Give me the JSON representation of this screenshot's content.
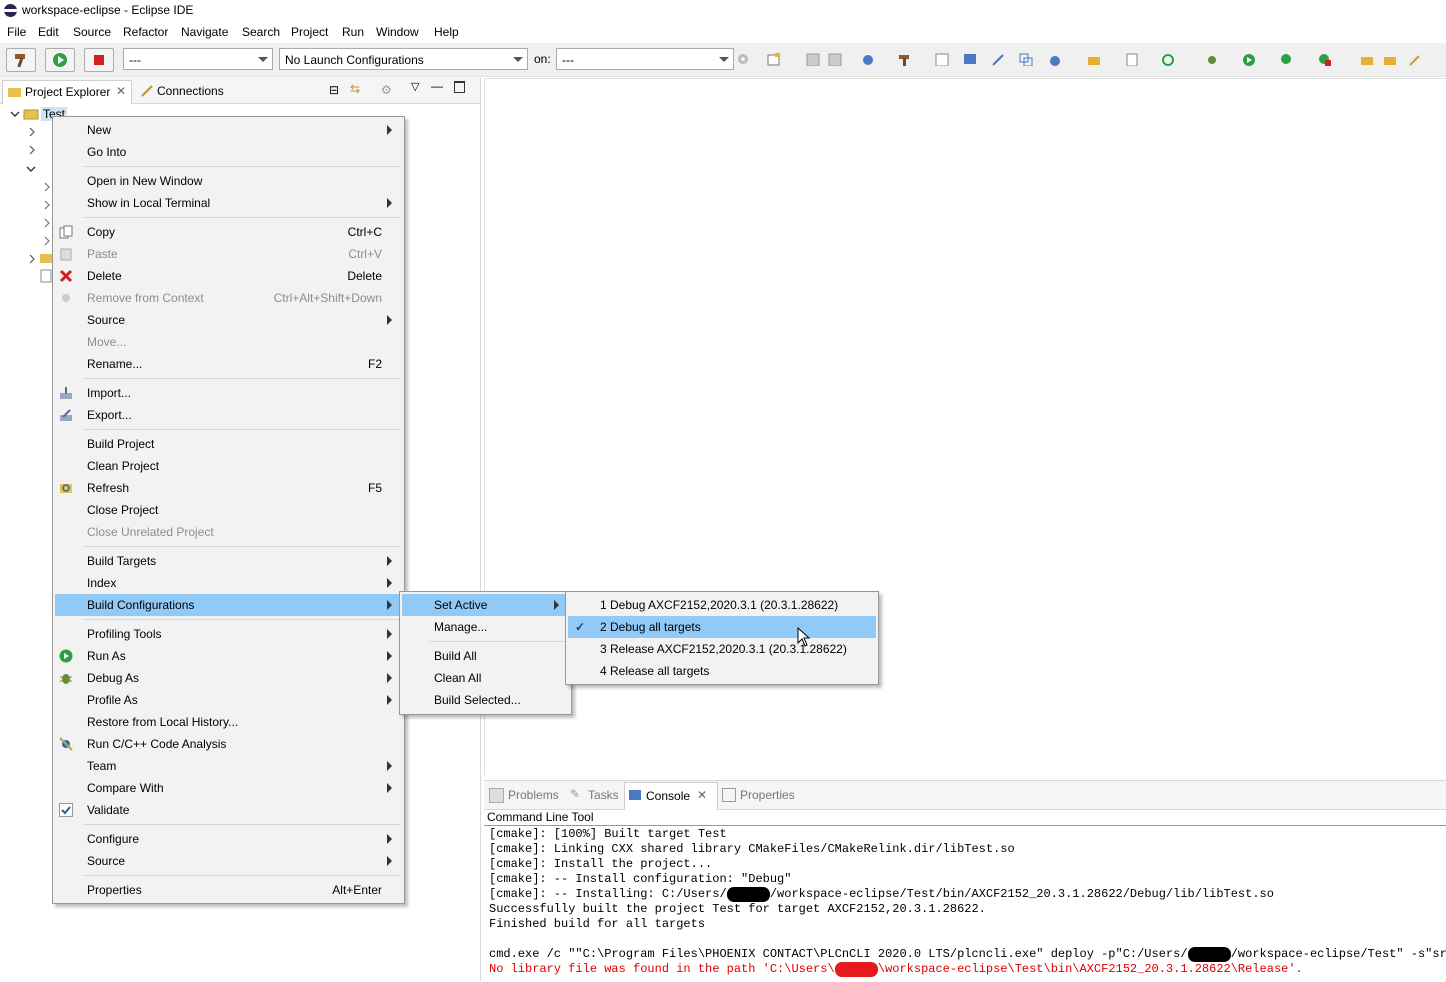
{
  "window": {
    "title": "workspace-eclipse - Eclipse IDE"
  },
  "menubar": [
    "File",
    "Edit",
    "Source",
    "Refactor",
    "Navigate",
    "Search",
    "Project",
    "Run",
    "Window",
    "Help"
  ],
  "toolbar": {
    "build_config_value": "---",
    "launch_config_value": "No Launch Configurations",
    "on_label": "on:",
    "target_value": "---"
  },
  "left_view": {
    "tabs": [
      {
        "label": "Project Explorer",
        "active": true
      },
      {
        "label": "Connections",
        "active": false
      }
    ],
    "tree_root": "Test"
  },
  "context_menu": {
    "items": [
      {
        "label": "New",
        "submenu": true
      },
      {
        "label": "Go Into"
      },
      {
        "sep": true
      },
      {
        "label": "Open in New Window"
      },
      {
        "label": "Show in Local Terminal",
        "submenu": true
      },
      {
        "sep": true
      },
      {
        "label": "Copy",
        "shortcut": "Ctrl+C",
        "icon": "copy-icon"
      },
      {
        "label": "Paste",
        "shortcut": "Ctrl+V",
        "icon": "paste-icon",
        "disabled": true
      },
      {
        "label": "Delete",
        "shortcut": "Delete",
        "icon": "delete-icon"
      },
      {
        "label": "Remove from Context",
        "shortcut": "Ctrl+Alt+Shift+Down",
        "icon": "remove-context-icon",
        "disabled": true
      },
      {
        "label": "Source",
        "submenu": true
      },
      {
        "label": "Move...",
        "disabled": true
      },
      {
        "label": "Rename...",
        "shortcut": "F2"
      },
      {
        "sep": true
      },
      {
        "label": "Import...",
        "icon": "import-icon"
      },
      {
        "label": "Export...",
        "icon": "export-icon"
      },
      {
        "sep": true
      },
      {
        "label": "Build Project"
      },
      {
        "label": "Clean Project"
      },
      {
        "label": "Refresh",
        "shortcut": "F5",
        "icon": "refresh-icon"
      },
      {
        "label": "Close Project"
      },
      {
        "label": "Close Unrelated Project",
        "disabled": true
      },
      {
        "sep": true
      },
      {
        "label": "Build Targets",
        "submenu": true
      },
      {
        "label": "Index",
        "submenu": true
      },
      {
        "label": "Build Configurations",
        "submenu": true,
        "highlighted": true
      },
      {
        "sep": true
      },
      {
        "label": "Profiling Tools",
        "submenu": true
      },
      {
        "label": "Run As",
        "submenu": true,
        "icon": "run-icon"
      },
      {
        "label": "Debug As",
        "submenu": true,
        "icon": "debug-icon"
      },
      {
        "label": "Profile As",
        "submenu": true
      },
      {
        "label": "Restore from Local History..."
      },
      {
        "label": "Run C/C++ Code Analysis",
        "icon": "code-analysis-icon"
      },
      {
        "label": "Team",
        "submenu": true
      },
      {
        "label": "Compare With",
        "submenu": true
      },
      {
        "label": "Validate",
        "icon": "validate-check-icon"
      },
      {
        "sep": true
      },
      {
        "label": "Configure",
        "submenu": true
      },
      {
        "label": "Source",
        "submenu": true
      },
      {
        "sep": true
      },
      {
        "label": "Properties",
        "shortcut": "Alt+Enter"
      }
    ]
  },
  "build_config_menu": {
    "items": [
      {
        "label": "Set Active",
        "submenu": true,
        "highlighted": true
      },
      {
        "label": "Manage..."
      },
      {
        "sep": true
      },
      {
        "label": "Build All"
      },
      {
        "label": "Clean All"
      },
      {
        "label": "Build Selected..."
      }
    ]
  },
  "set_active_menu": {
    "items": [
      {
        "label": "1 Debug AXCF2152,2020.3.1 (20.3.1.28622)"
      },
      {
        "label": "2 Debug all targets",
        "checked": true,
        "highlighted": true
      },
      {
        "label": "3 Release AXCF2152,2020.3.1 (20.3.1.28622)"
      },
      {
        "label": "4 Release all targets"
      }
    ]
  },
  "console_view": {
    "tabs": [
      "Problems",
      "Tasks",
      "Console",
      "Properties"
    ],
    "active_tab": "Console",
    "header": "Command Line Tool",
    "lines": [
      "[cmake]: [100%] Built target Test",
      "[cmake]: Linking CXX shared library CMakeFiles/CMakeRelink.dir/libTest.so",
      "[cmake]: Install the project...",
      "[cmake]: -- Install configuration: \"Debug\"",
      "[cmake]: -- Installing: C:/Users/",
      "/workspace-eclipse/Test/bin/AXCF2152_20.3.1.28622/Debug/lib/libTest.so",
      "Successfully built the project Test for target AXCF2152,20.3.1.28622.",
      "Finished build for all targets",
      "cmd.exe /c \"\"C:\\Program Files\\PHOENIX CONTACT\\PLCnCLI 2020.0 LTS/plcncli.exe\" deploy -p\"C:/Users/",
      "/workspace-eclipse/Test\" -s\"src\"\"",
      "No library file was found in the path 'C:\\Users\\",
      "\\workspace-eclipse\\Test\\bin\\AXCF2152_20.3.1.28622\\Release'."
    ],
    "error_color": "#e00000"
  },
  "colors": {
    "highlight": "#91c9f7",
    "menu_bg": "#f2f2f2"
  }
}
